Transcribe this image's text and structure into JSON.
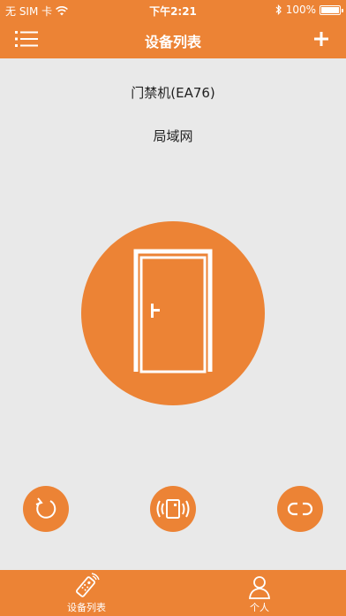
{
  "status_bar": {
    "carrier": "无 SIM 卡",
    "time": "下午2:21",
    "battery": "100%",
    "battery_level": 1.0,
    "icons": [
      "wifi-icon",
      "bluetooth-icon",
      "battery-icon"
    ]
  },
  "nav_bar": {
    "title": "设备列表",
    "left_icon": "menu-list-icon",
    "right_icon": "plus-icon"
  },
  "device": {
    "name": "门禁机(EA76)",
    "network": "局域网",
    "icon": "door-icon"
  },
  "actions": [
    {
      "icon": "refresh-icon"
    },
    {
      "icon": "nfc-card-icon"
    },
    {
      "icon": "link-icon"
    }
  ],
  "tab_bar": {
    "tabs": [
      {
        "label": "设备列表",
        "icon": "remote-control-icon"
      },
      {
        "label": "个人",
        "icon": "person-icon"
      }
    ]
  },
  "colors": {
    "accent": "#ec8335",
    "background": "#e9e9e9",
    "text": "#222222"
  }
}
